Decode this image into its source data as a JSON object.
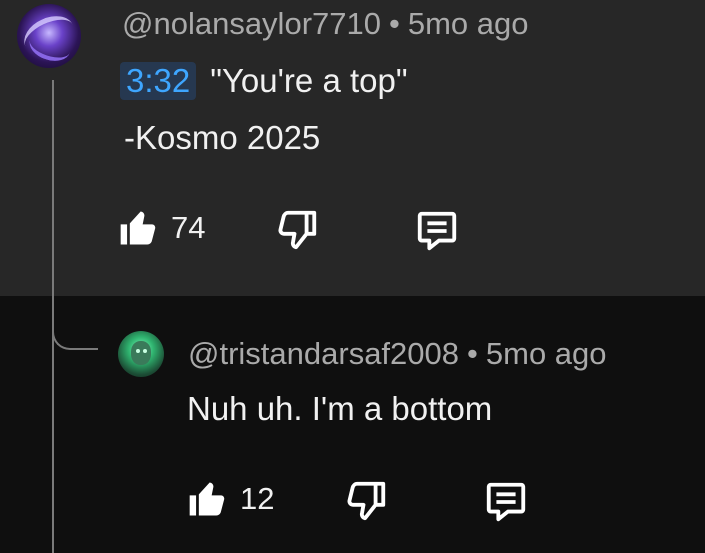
{
  "comment": {
    "username": "@nolansaylor7710",
    "separator": "•",
    "time": "5mo ago",
    "timestamp_link": "3:32",
    "text_line1": "\"You're a top\"",
    "text_line2": "-Kosmo 2025",
    "likes": "74",
    "icons": [
      "thumbs-up-icon",
      "thumbs-down-icon",
      "reply-icon"
    ]
  },
  "reply": {
    "username": "@tristandarsaf2008",
    "separator": "•",
    "time": "5mo ago",
    "text": "Nuh uh. I'm a bottom",
    "likes": "12",
    "icons": [
      "thumbs-up-icon",
      "thumbs-down-icon",
      "reply-icon"
    ]
  }
}
